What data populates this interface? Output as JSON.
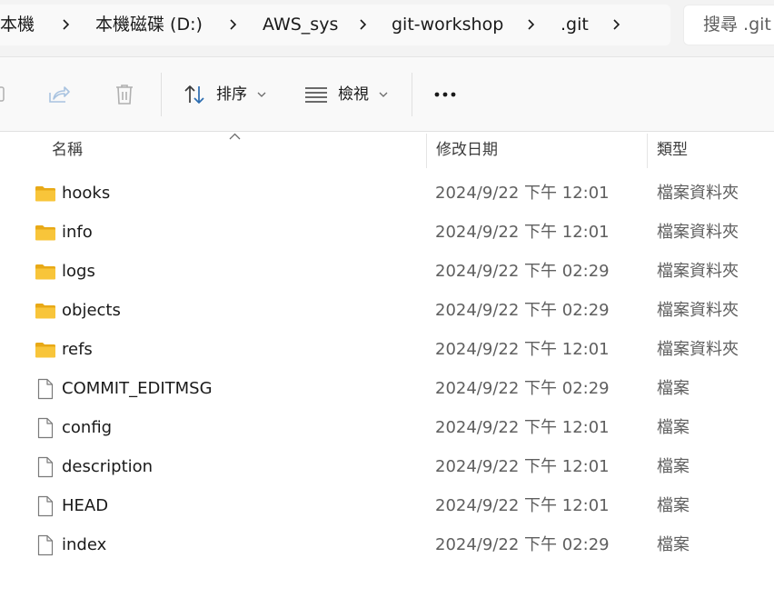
{
  "breadcrumb": {
    "items": [
      "本機",
      "本機磁碟 (D:)",
      "AWS_sys",
      "git-workshop",
      ".git"
    ]
  },
  "search": {
    "placeholder": "搜尋 .git"
  },
  "toolbar": {
    "sort_label": "排序",
    "view_label": "檢視"
  },
  "columns": {
    "name": "名稱",
    "date": "修改日期",
    "type": "類型"
  },
  "files": [
    {
      "name": "hooks",
      "date": "2024/9/22 下午 12:01",
      "type": "檔案資料夾",
      "kind": "folder"
    },
    {
      "name": "info",
      "date": "2024/9/22 下午 12:01",
      "type": "檔案資料夾",
      "kind": "folder"
    },
    {
      "name": "logs",
      "date": "2024/9/22 下午 02:29",
      "type": "檔案資料夾",
      "kind": "folder"
    },
    {
      "name": "objects",
      "date": "2024/9/22 下午 02:29",
      "type": "檔案資料夾",
      "kind": "folder"
    },
    {
      "name": "refs",
      "date": "2024/9/22 下午 12:01",
      "type": "檔案資料夾",
      "kind": "folder"
    },
    {
      "name": "COMMIT_EDITMSG",
      "date": "2024/9/22 下午 02:29",
      "type": "檔案",
      "kind": "file"
    },
    {
      "name": "config",
      "date": "2024/9/22 下午 12:01",
      "type": "檔案",
      "kind": "file"
    },
    {
      "name": "description",
      "date": "2024/9/22 下午 12:01",
      "type": "檔案",
      "kind": "file"
    },
    {
      "name": "HEAD",
      "date": "2024/9/22 下午 12:01",
      "type": "檔案",
      "kind": "file"
    },
    {
      "name": "index",
      "date": "2024/9/22 下午 02:29",
      "type": "檔案",
      "kind": "file"
    }
  ],
  "colors": {
    "folder": "#f8c53a",
    "folder_tab": "#e8a917",
    "accent": "#2b6cb0"
  }
}
